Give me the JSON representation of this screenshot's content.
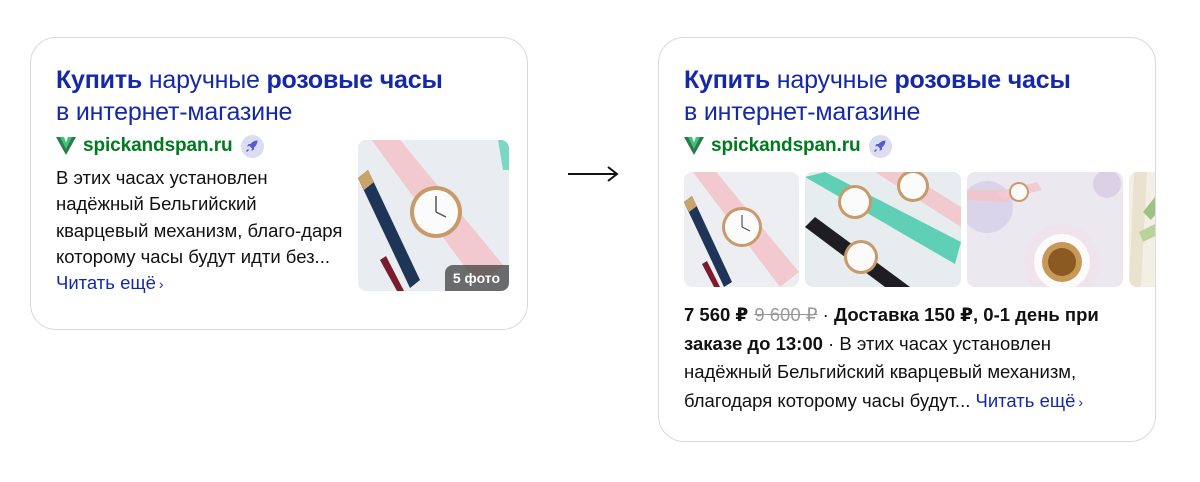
{
  "left_card": {
    "title_strong_1": "Купить",
    "title_normal_1": " наручные ",
    "title_strong_2": "розовые часы",
    "title_line2": "в интернет-магазине",
    "domain": "spickandspan.ru",
    "snippet": "В этих часах установлен надёжный Бельгийский кварцевый механизм, благо-даря которому часы будут идти без...",
    "read_more": "Читать ещё",
    "photo_count": "5 фото"
  },
  "right_card": {
    "title_strong_1": "Купить",
    "title_normal_1": " наручные ",
    "title_strong_2": "розовые часы",
    "title_line2": "в интернет-магазине",
    "domain": "spickandspan.ru",
    "price": "7 560 ₽",
    "old_price": "9 600 ₽",
    "separator": " · ",
    "delivery": "Доставка 150 ₽, 0-1 день при заказе до 13:00",
    "snippet": " · В этих часах установлен надёжный Бельгийский кварцевый механизм, благодаря которому часы будут...",
    "read_more": "Читать ещё"
  },
  "arrow": "→",
  "colors": {
    "title": "#1428a8",
    "domain": "#007a1f",
    "border": "#d9d9de"
  },
  "icons": [
    "v-logo-icon",
    "rocket-badge-icon",
    "chevron-right-icon",
    "arrow-right-icon"
  ]
}
